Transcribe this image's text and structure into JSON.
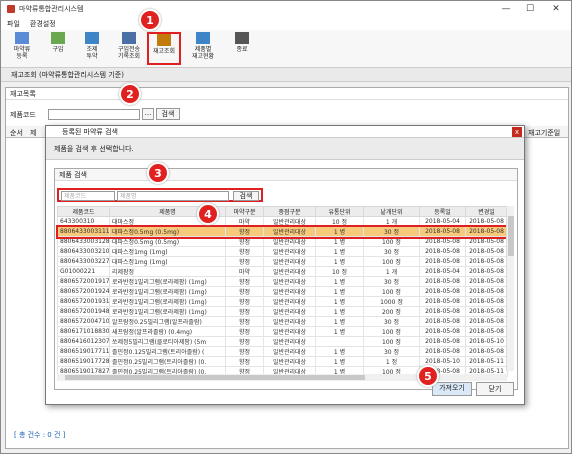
{
  "window": {
    "title": "마약류통합관리시스템",
    "minimize": "—",
    "maximize": "☐",
    "close": "✕"
  },
  "menu": [
    "파일",
    "환경설정"
  ],
  "toolbar": [
    {
      "name": "drug-register",
      "label": "마약류\n등록",
      "color": "#5a8bd6"
    },
    {
      "name": "purchase",
      "label": "구입",
      "color": "#6aa84f"
    },
    {
      "name": "prep-dose",
      "label": "조제\n투약",
      "color": "#3d85c6"
    },
    {
      "name": "purchase-prep-record",
      "label": "구입전송\n기록조회",
      "color": "#4a6fa5"
    },
    {
      "name": "stock-lookup",
      "label": "재고조회",
      "color": "#c27c0e"
    },
    {
      "name": "product-stock",
      "label": "제품별\n재고현황",
      "color": "#3d85c6"
    },
    {
      "name": "exit",
      "label": "종료",
      "color": "#555555"
    }
  ],
  "section_title": "재고조회 (마약류통합관리시스템 기준)",
  "panel": {
    "title": "재고목록",
    "code_label": "제품코드",
    "search_btn": "검색",
    "ellipsis": "...",
    "col_seq": "순서",
    "col_cut": "제",
    "col_right": "재고기준일",
    "footer": "[ 총 건수 : 0 건 ]"
  },
  "dialog": {
    "title": "등록된 마약류 검색",
    "close": "x",
    "desc": "제품을 검색 후 선택합니다.",
    "box_title": "제품 검색",
    "code_placeholder": "제품코드",
    "name_placeholder": "제품명",
    "search_btn": "검색",
    "ok_btn": "가져오기",
    "close_btn": "닫기",
    "columns": [
      "제품코드",
      "제품명",
      "마약구분",
      "중점구분",
      "유통단위",
      "낱개단위",
      "등록일",
      "변경일"
    ],
    "rows": [
      [
        "643300310",
        "대마스정",
        "마약",
        "일반관리대상",
        "10 정",
        "1 개",
        "2018-05-04",
        "2018-05-08"
      ],
      [
        "8806433003111",
        "대파스정0.5mg (0.5mg)",
        "향정",
        "일반관리대상",
        "1 병",
        "30 정",
        "2018-05-08",
        "2018-05-08"
      ],
      [
        "8806433003128",
        "대파스정0.5mg (0.5mg)",
        "향정",
        "일반관리대상",
        "1 병",
        "100 정",
        "2018-05-08",
        "2018-05-08"
      ],
      [
        "8806433003210",
        "대파스정1mg (1mg)",
        "향정",
        "일반관리대상",
        "1 병",
        "30 정",
        "2018-05-08",
        "2018-05-08"
      ],
      [
        "8806433003227",
        "대파스정1mg (1mg)",
        "향정",
        "일반관리대상",
        "1 병",
        "100 정",
        "2018-05-08",
        "2018-05-08"
      ],
      [
        "G01000221",
        "리제팜정",
        "마약",
        "일반관리대상",
        "10 정",
        "1 개",
        "2018-05-04",
        "2018-05-08"
      ],
      [
        "8806572001917",
        "로라반정1밀리그램(로라제팜) (1mg)",
        "향정",
        "일반관리대상",
        "1 병",
        "30 정",
        "2018-05-08",
        "2018-05-08"
      ],
      [
        "8806572001924",
        "로라반정1밀리그램(로라제팜) (1mg)",
        "향정",
        "일반관리대상",
        "1 병",
        "100 정",
        "2018-05-08",
        "2018-05-08"
      ],
      [
        "8806572001931",
        "로라반정1밀리그램(로라제팜) (1mg)",
        "향정",
        "일반관리대상",
        "1 병",
        "1000 정",
        "2018-05-08",
        "2018-05-08"
      ],
      [
        "8806572001948",
        "로라반정1밀리그램(로라제팜) (1mg)",
        "향정",
        "일반관리대상",
        "1 병",
        "200 정",
        "2018-05-08",
        "2018-05-08"
      ],
      [
        "8806572004710",
        "알프람정0.25밀리그램(알프라졸람)",
        "향정",
        "일반관리대상",
        "1 병",
        "30 정",
        "2018-05-08",
        "2018-05-08"
      ],
      [
        "8806171018830",
        "새프람정(알프라졸람) (0.4mg)",
        "향정",
        "일반관리대상",
        "1 병",
        "100 정",
        "2018-05-08",
        "2018-05-08"
      ],
      [
        "8806416012307",
        "쏘제정5밀리그램(클로티아제팜) (5m",
        "향정",
        "일반관리대상",
        "",
        "100 정",
        "2018-05-08",
        "2018-05-10"
      ],
      [
        "8806519017711",
        "졸민정0.125밀리그램(트리아졸람) (",
        "향정",
        "일반관리대상",
        "1 병",
        "30 정",
        "2018-05-08",
        "2018-05-08"
      ],
      [
        "8806519017728",
        "졸민정0.25밀리그램(트리아졸람) (0.",
        "향정",
        "일반관리대상",
        "1 병",
        "1 정",
        "2018-05-10",
        "2018-05-11"
      ],
      [
        "8806519017827",
        "졸민정0.25밀리그램(트리아졸람) (0.",
        "향정",
        "일반관리대상",
        "1 병",
        "100 정",
        "2018-05-08",
        "2018-05-11"
      ]
    ],
    "selected_row": 1
  },
  "badges": [
    "1",
    "2",
    "3",
    "4",
    "5"
  ]
}
